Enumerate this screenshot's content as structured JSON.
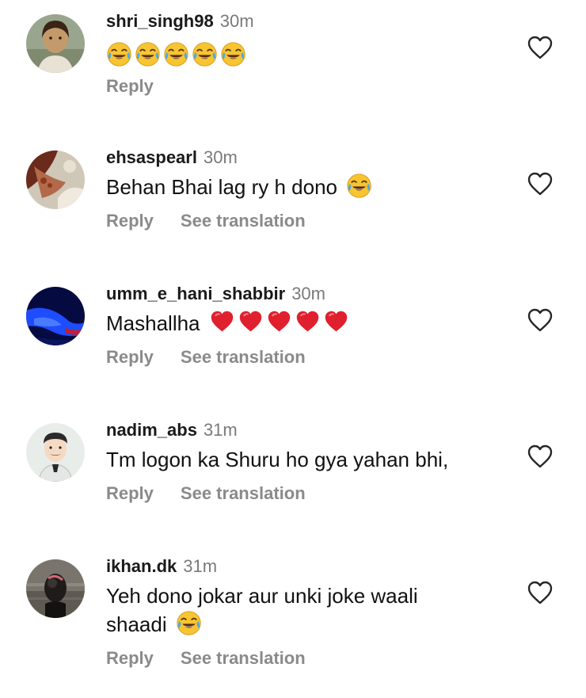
{
  "comments": [
    {
      "username": "shri_singh98",
      "time": "30m",
      "text": "",
      "reply_label": "Reply",
      "translation_label": ""
    },
    {
      "username": "ehsaspearl",
      "time": "30m",
      "text": "Behan Bhai lag ry h dono",
      "reply_label": "Reply",
      "translation_label": "See translation"
    },
    {
      "username": "umm_e_hani_shabbir",
      "time": "30m",
      "text": "Mashallha",
      "reply_label": "Reply",
      "translation_label": "See translation"
    },
    {
      "username": "nadim_abs",
      "time": "31m",
      "text": "Tm logon ka Shuru ho gya yahan bhi,",
      "reply_label": "Reply",
      "translation_label": "See translation"
    },
    {
      "username": "ikhan.dk",
      "time": "31m",
      "text_line1": "Yeh dono jokar aur unki joke waali",
      "text_line2": "shaadi",
      "reply_label": "Reply",
      "translation_label": "See translation"
    }
  ],
  "icons": {
    "like": "heart-outline-icon",
    "laugh": "face-with-tears-of-joy-emoji",
    "heart": "red-heart-emoji"
  },
  "colors": {
    "username": "#1a1a1a",
    "timestamp": "#7a7a7a",
    "action_text": "#8a8a8a",
    "heart_emoji": "#e0202e",
    "laugh_emoji": "#f7c531"
  }
}
